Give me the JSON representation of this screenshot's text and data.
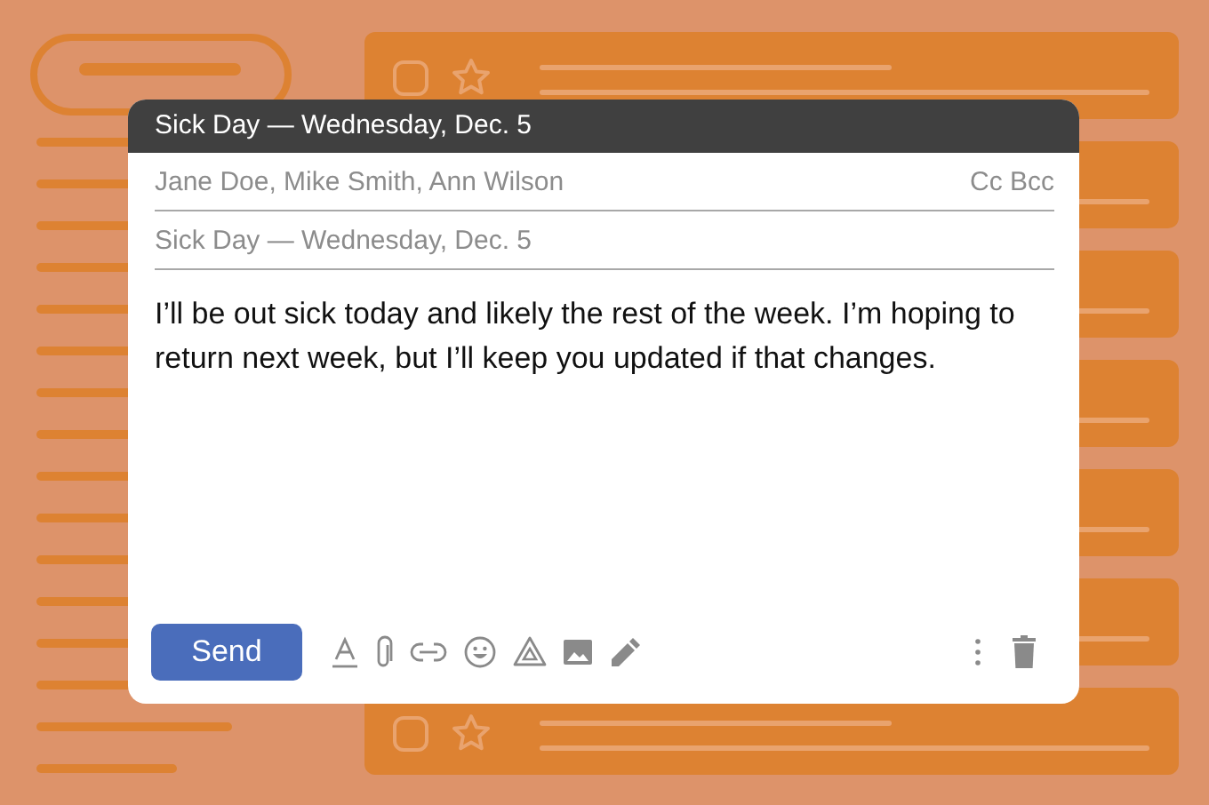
{
  "window": {
    "title": "Sick Day — Wednesday, Dec. 5"
  },
  "recipients": {
    "value": "Jane Doe, Mike Smith, Ann Wilson"
  },
  "cc_bcc": "Cc Bcc",
  "subject": {
    "value": "Sick Day — Wednesday, Dec. 5"
  },
  "body": "I’ll be out sick today and likely the rest of the week. I’m hoping to return next week, but I’ll keep you updated if that changes.",
  "send_button": "Send"
}
